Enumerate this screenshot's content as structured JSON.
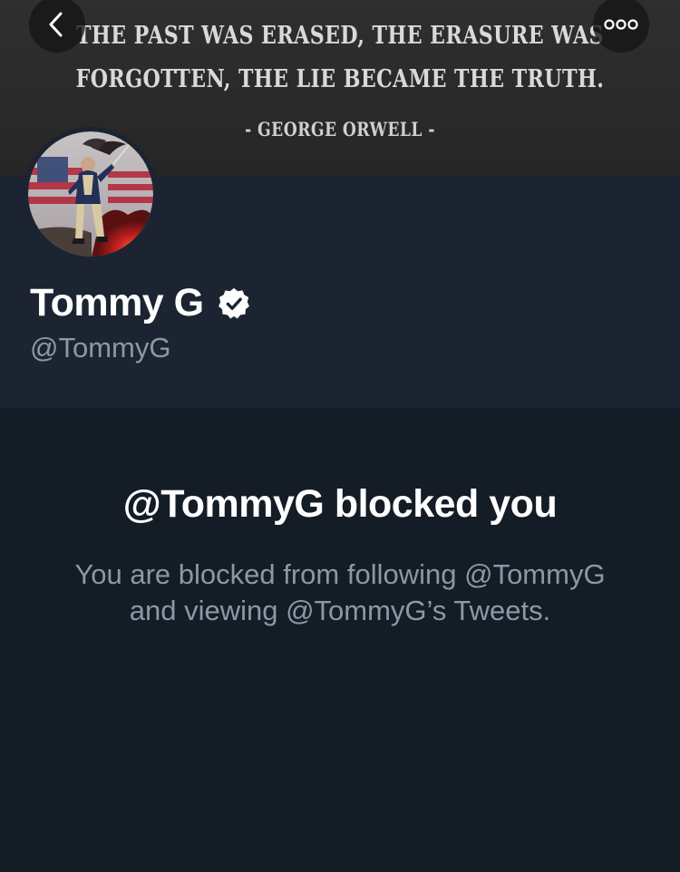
{
  "banner": {
    "quote_line_1": "THE PAST WAS ERASED, THE ERASURE WAS",
    "quote_line_2": "FORGOTTEN, THE LIE BECAME THE TRUTH.",
    "quote_author": "- GEORGE ORWELL -"
  },
  "nav": {
    "back_icon": "chevron-left-icon",
    "more_icon": "more-horizontal-icon"
  },
  "profile": {
    "display_name": "Tommy G",
    "handle": "@TommyG",
    "verified": true,
    "verified_icon": "verified-badge-icon"
  },
  "blocked": {
    "title": "@TommyG blocked you",
    "description": "You are blocked from following @TommyG and viewing @TommyG’s Tweets."
  },
  "colors": {
    "background": "#141c26",
    "profile_background": "#1b2430",
    "text_primary": "#ffffff",
    "text_secondary": "#8b98a6"
  }
}
